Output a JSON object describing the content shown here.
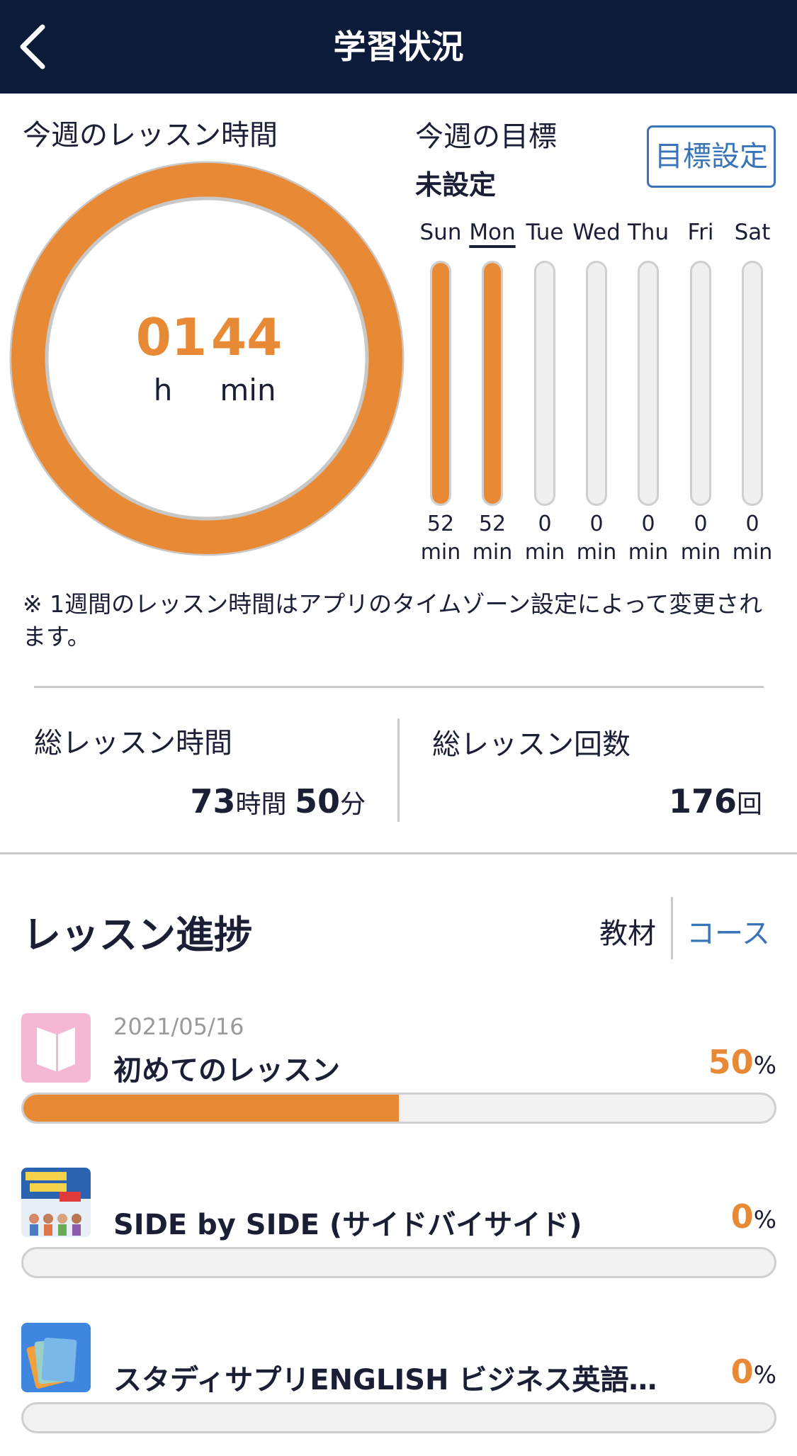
{
  "header": {
    "title": "学習状況"
  },
  "week": {
    "label": "今週のレッスン時間",
    "hours": "01",
    "minutes": "44",
    "hours_unit": "h",
    "minutes_unit": "min",
    "ring_progress": 1.0,
    "ring_color": "#e88a35"
  },
  "goal": {
    "label": "今週の目標",
    "value": "未設定",
    "button_label": "目標設定"
  },
  "days": [
    {
      "label": "Sun",
      "value": "52",
      "unit": "min",
      "minutes": 52,
      "today": false
    },
    {
      "label": "Mon",
      "value": "52",
      "unit": "min",
      "minutes": 52,
      "today": true
    },
    {
      "label": "Tue",
      "value": "0",
      "unit": "min",
      "minutes": 0,
      "today": false
    },
    {
      "label": "Wed",
      "value": "0",
      "unit": "min",
      "minutes": 0,
      "today": false
    },
    {
      "label": "Thu",
      "value": "0",
      "unit": "min",
      "minutes": 0,
      "today": false
    },
    {
      "label": "Fri",
      "value": "0",
      "unit": "min",
      "minutes": 0,
      "today": false
    },
    {
      "label": "Sat",
      "value": "0",
      "unit": "min",
      "minutes": 0,
      "today": false
    }
  ],
  "note": "※ 1週間のレッスン時間はアプリのタイムゾーン設定によって変更されます。",
  "totals": {
    "time_label": "総レッスン時間",
    "hours": "73",
    "hours_unit": "時間",
    "minutes": "50",
    "minutes_unit": "分",
    "count_label": "総レッスン回数",
    "count": "176",
    "count_unit": "回"
  },
  "progress": {
    "title": "レッスン進捗",
    "tab_material": "教材",
    "tab_course": "コース",
    "courses": [
      {
        "date": "2021/05/16",
        "name": "初めてのレッスン",
        "percent": "50",
        "percent_unit": "%",
        "progress": 0.5,
        "icon": "book-icon"
      },
      {
        "date": "",
        "name": "SIDE by SIDE (サイドバイサイド)",
        "percent": "0",
        "percent_unit": "%",
        "progress": 0,
        "icon": "side-by-side-cover"
      },
      {
        "date": "",
        "name": "スタディサプリENGLISH ビジネス英語…",
        "percent": "0",
        "percent_unit": "%",
        "progress": 0,
        "icon": "cards-stack-icon"
      }
    ]
  },
  "colors": {
    "accent": "#e88a35",
    "navy": "#0d1b3a",
    "link": "#3a74b8"
  }
}
